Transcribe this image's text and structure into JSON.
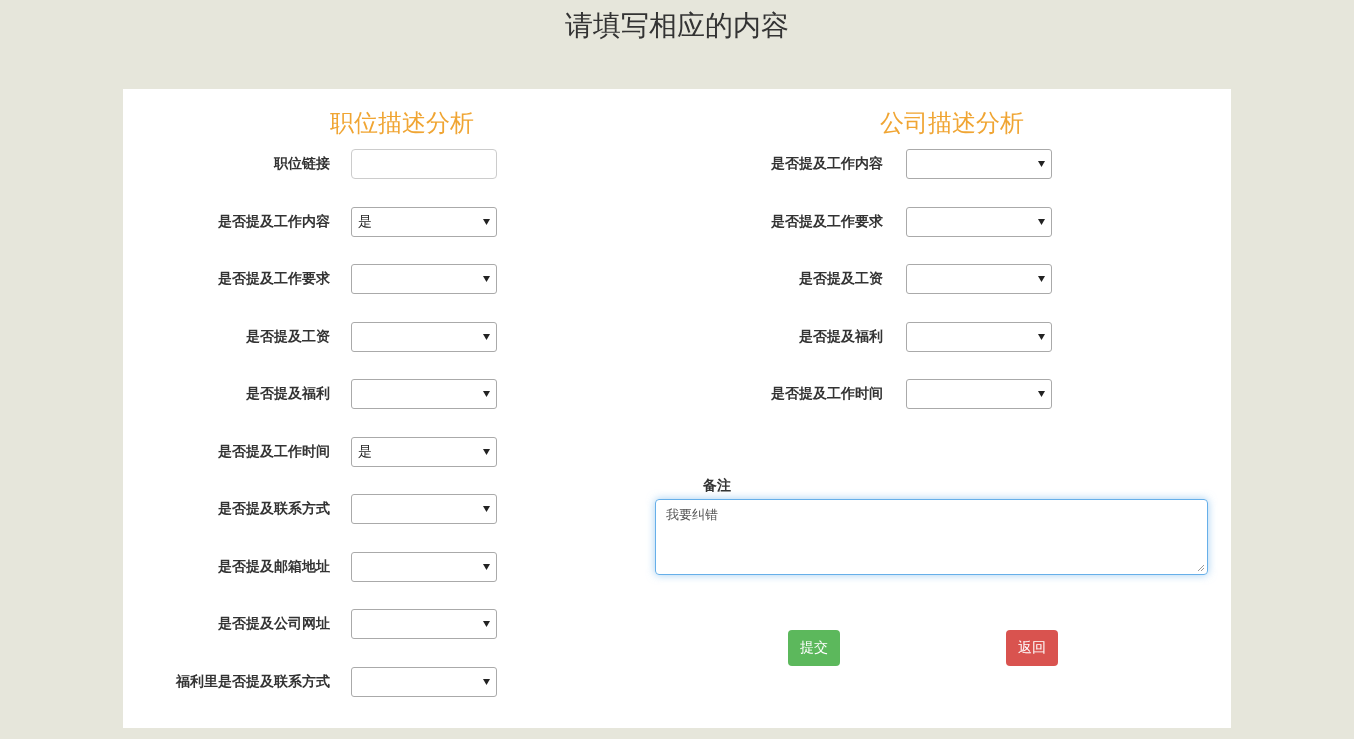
{
  "title": "请填写相应的内容",
  "job": {
    "heading": "职位描述分析",
    "fields": [
      {
        "label": "职位链接",
        "kind": "text"
      },
      {
        "label": "是否提及工作内容",
        "kind": "select",
        "value": "是"
      },
      {
        "label": "是否提及工作要求",
        "kind": "select"
      },
      {
        "label": "是否提及工资",
        "kind": "select"
      },
      {
        "label": "是否提及福利",
        "kind": "select"
      },
      {
        "label": "是否提及工作时间",
        "kind": "select",
        "value": "是"
      },
      {
        "label": "是否提及联系方式",
        "kind": "select"
      },
      {
        "label": "是否提及邮箱地址",
        "kind": "select"
      },
      {
        "label": "是否提及公司网址",
        "kind": "select"
      },
      {
        "label": "福利里是否提及联系方式",
        "kind": "select"
      }
    ]
  },
  "company": {
    "heading": "公司描述分析",
    "fields": [
      {
        "label": "是否提及工作内容",
        "kind": "select"
      },
      {
        "label": "是否提及工作要求",
        "kind": "select"
      },
      {
        "label": "是否提及工资",
        "kind": "select"
      },
      {
        "label": "是否提及福利",
        "kind": "select"
      },
      {
        "label": "是否提及工作时间",
        "kind": "select"
      }
    ]
  },
  "remarks": {
    "label": "备注",
    "value": "我要纠错",
    "focused": true
  },
  "buttons": [
    {
      "label": "提交",
      "kind": "primary"
    },
    {
      "label": "返回",
      "kind": "danger"
    }
  ]
}
